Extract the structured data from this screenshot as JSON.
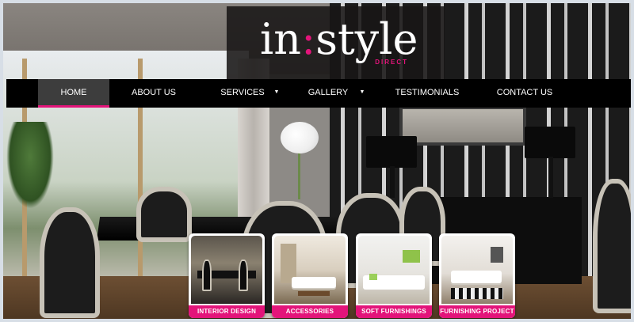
{
  "brand": {
    "logo_main_left": "in",
    "logo_colon": ":",
    "logo_main_right": "style",
    "logo_sub": "DIRECT",
    "accent_color": "#e3147a"
  },
  "nav": {
    "items": [
      {
        "label": "HOME",
        "active": true
      },
      {
        "label": "ABOUT US",
        "active": false
      },
      {
        "label": "SERVICES",
        "active": false,
        "has_dropdown": true
      },
      {
        "label": "GALLERY",
        "active": false,
        "has_dropdown": true
      },
      {
        "label": "TESTIMONIALS",
        "active": false
      },
      {
        "label": "CONTACT US",
        "active": false
      }
    ],
    "dropdown_icon": "triangle-down-icon"
  },
  "features": [
    {
      "label": "INTERIOR DESIGN"
    },
    {
      "label": "ACCESSORIES"
    },
    {
      "label": "SOFT FURNISHINGS"
    },
    {
      "label": "FURNISHING PROJECT"
    }
  ]
}
